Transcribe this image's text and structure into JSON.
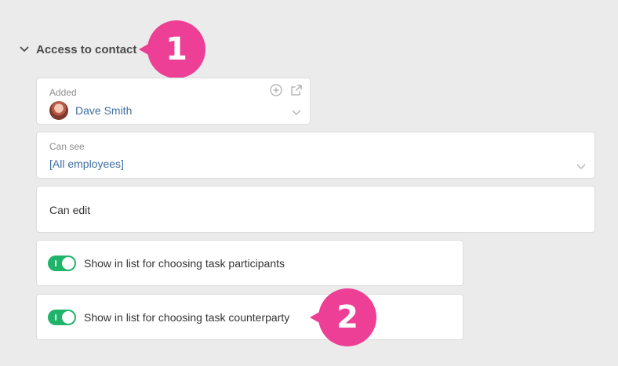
{
  "section": {
    "title": "Access to contact",
    "chevron_icon": "chevron-down-icon"
  },
  "added": {
    "label": "Added",
    "user_name": "Dave Smith",
    "add_icon": "plus-circle-icon",
    "open_icon": "external-link-icon",
    "dropdown_icon": "chevron-down-icon"
  },
  "can_see": {
    "label": "Can see",
    "value": "[All employees]",
    "dropdown_icon": "chevron-down-icon"
  },
  "can_edit": {
    "label": "Can edit"
  },
  "toggles": [
    {
      "label": "Show in list for choosing task participants",
      "on": true
    },
    {
      "label": "Show in list for choosing task counterparty",
      "on": true
    }
  ],
  "callouts": [
    "1",
    "2"
  ],
  "colors": {
    "background": "#ebebeb",
    "accent_link": "#3f6fa3",
    "toggle_on": "#20b36a",
    "callout": "#ec3f95"
  }
}
